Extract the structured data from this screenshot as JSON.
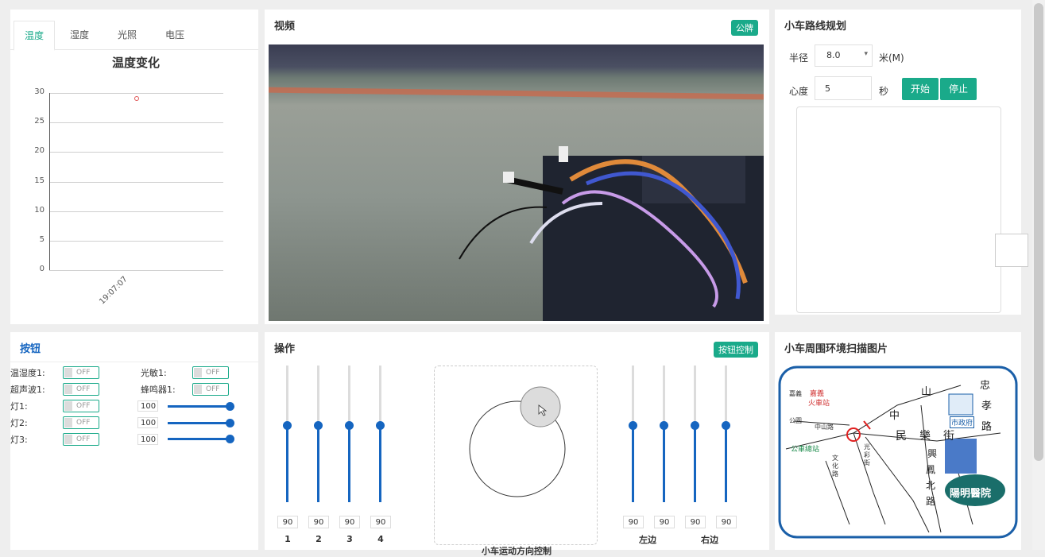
{
  "chart_panel": {
    "tabs": [
      "温度",
      "湿度",
      "光照",
      "电压"
    ],
    "active_tab": 0
  },
  "chart_data": {
    "type": "scatter",
    "title": "温度变化",
    "x": [
      "19:07:07"
    ],
    "series": [
      {
        "values": [
          29
        ]
      }
    ],
    "ylim": [
      0,
      30
    ],
    "yticks": [
      0,
      5,
      10,
      15,
      20,
      25,
      30
    ],
    "grid": true,
    "point_color": "#e05555"
  },
  "video_panel": {
    "title": "视频",
    "badge": "公牌"
  },
  "route_panel": {
    "title": "小车路线规划",
    "radius_label": "半径",
    "radius_value": "8.0",
    "radius_unit": "米(M)",
    "speed_label": "心度",
    "speed_value": "5",
    "speed_unit": "秒",
    "start_label": "开始",
    "stop_label": "停止"
  },
  "button_panel": {
    "title": "按钮",
    "left": [
      {
        "label": "温湿度1:",
        "state": "OFF"
      },
      {
        "label": "超声波1:",
        "state": "OFF"
      },
      {
        "label": "灯1:",
        "state": "OFF"
      },
      {
        "label": "灯2:",
        "state": "OFF"
      },
      {
        "label": "灯3:",
        "state": "OFF"
      }
    ],
    "right": [
      {
        "label": "光敏1:",
        "state": "OFF"
      },
      {
        "label": "蜂鸣器1:",
        "state": "OFF"
      }
    ],
    "sliders": [
      "100",
      "100",
      "100"
    ]
  },
  "ops_panel": {
    "title": "操作",
    "badge": "按钮控制",
    "left_sliders": [
      {
        "value": "90",
        "label": "1"
      },
      {
        "value": "90",
        "label": "2"
      },
      {
        "value": "90",
        "label": "3"
      },
      {
        "value": "90",
        "label": "4"
      }
    ],
    "right_sliders": [
      {
        "value": "90",
        "label": ""
      },
      {
        "value": "90",
        "label": ""
      },
      {
        "value": "90",
        "label": ""
      },
      {
        "value": "90",
        "label": ""
      }
    ],
    "right_group_labels": [
      "左边",
      "右边"
    ],
    "joystick_caption": "小车运动方向控制"
  },
  "map_panel": {
    "title": "小车周围环境扫描图片",
    "labels": [
      "嘉義",
      "火車站",
      "市政府",
      "中山路",
      "中",
      "民",
      "樂",
      "街",
      "忠",
      "孝",
      "路",
      "山",
      "文化路",
      "光彩街",
      "公車總站",
      "陽明醫院",
      "興",
      "鳳",
      "北",
      "路",
      "嘉義",
      "公園"
    ]
  }
}
